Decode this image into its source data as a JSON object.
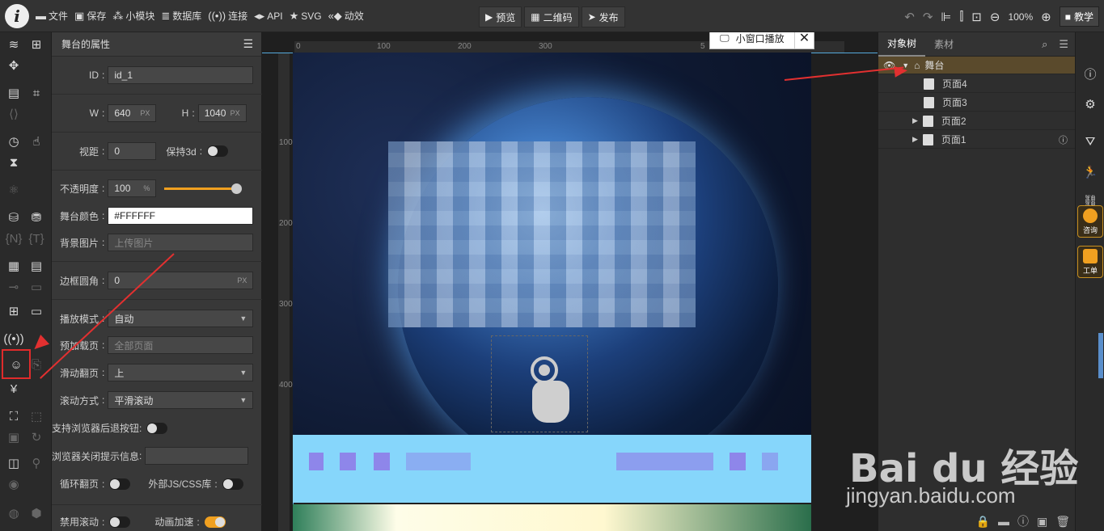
{
  "topbar": {
    "logo": "i",
    "items": [
      {
        "icon": "folder-icon",
        "label": "文件"
      },
      {
        "icon": "save-icon",
        "label": "保存"
      },
      {
        "icon": "module-icon",
        "label": "小模块"
      },
      {
        "icon": "database-icon",
        "label": "数据库"
      },
      {
        "icon": "connect-icon",
        "label": "连接"
      },
      {
        "icon": "api-icon",
        "label": "API"
      },
      {
        "icon": "star-icon",
        "label": "SVG"
      },
      {
        "icon": "motion-icon",
        "label": "动效"
      }
    ],
    "center": [
      {
        "icon": "play-icon",
        "label": "预览"
      },
      {
        "icon": "qrcode-icon",
        "label": "二维码"
      },
      {
        "icon": "send-icon",
        "label": "发布"
      }
    ],
    "zoom": "100%",
    "teach_label": "教学"
  },
  "props": {
    "header": "舞台的属性",
    "id_label": "ID",
    "id_value": "id_1",
    "w_label": "W",
    "w_value": "640",
    "h_label": "H",
    "h_value": "1040",
    "px_unit": "PX",
    "perspective_label": "视距",
    "perspective_value": "0",
    "keep3d_label": "保持3d",
    "opacity_label": "不透明度",
    "opacity_value": "100",
    "opacity_unit": "%",
    "opacity_level": 1.0,
    "color_label": "舞台颜色",
    "color_value": "#FFFFFF",
    "bg_label": "背景图片",
    "bg_placeholder": "上传图片",
    "radius_label": "边框圆角",
    "radius_value": "0",
    "play_label": "播放模式",
    "play_value": "自动",
    "preload_label": "预加载页",
    "preload_placeholder": "全部页面",
    "slide_label": "滑动翻页",
    "slide_value": "上",
    "scroll_label": "滚动方式",
    "scroll_value": "平滑滚动",
    "back_label": "支持浏览器后退按钮",
    "close_tip_label": "浏览器关闭提示信息",
    "loop_label": "循环翻页",
    "extlib_label": "外部JS/CSS库",
    "noscroll_label": "禁用滚动",
    "accel_label": "动画加速"
  },
  "canvas": {
    "ruler_h": [
      "0",
      "100",
      "200",
      "300",
      "5"
    ],
    "ruler_v": [
      "100",
      "200",
      "300",
      "400"
    ],
    "popup_label": "小窗口播放"
  },
  "tree": {
    "tabs": [
      "对象树",
      "素材"
    ],
    "stage": "舞台",
    "pages": [
      "页面4",
      "页面3",
      "页面2",
      "页面1"
    ]
  },
  "side": {
    "consult": "咨询",
    "ticket": "工单"
  },
  "watermark": {
    "brand": "Bai du 经验",
    "url": "jingyan.baidu.com"
  },
  "colors": {
    "accent": "#f0a020",
    "highlight": "#e02b2b",
    "guide": "#55aadd"
  }
}
